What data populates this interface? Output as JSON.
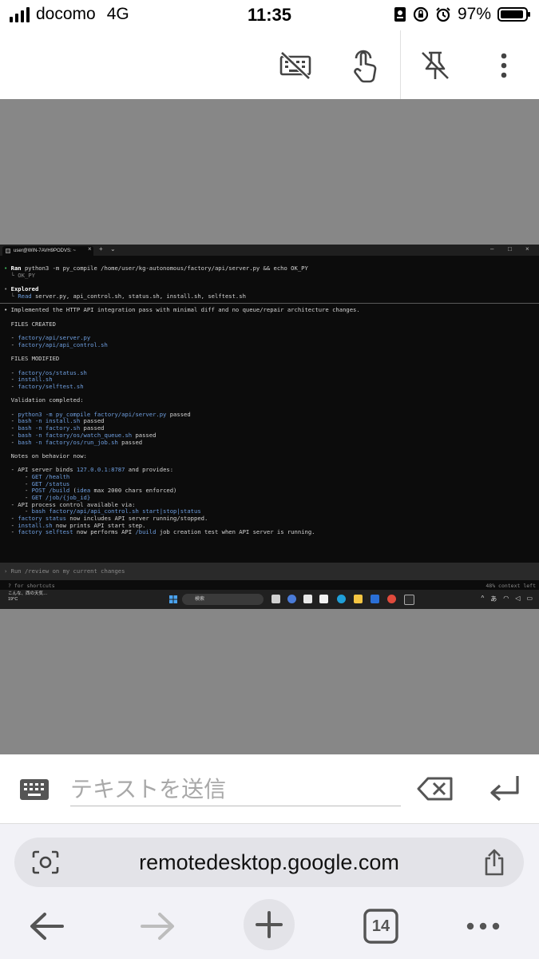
{
  "status_bar": {
    "carrier": "docomo",
    "network": "4G",
    "time": "11:35",
    "battery_percent": "97%",
    "battery_level": 0.97
  },
  "terminal": {
    "tab_title": "user@WIN-7AVH9PODVS: ~",
    "lines": [
      {
        "segs": [
          {
            "t": "• ",
            "c": "green"
          },
          {
            "t": "Ran ",
            "c": "bold"
          },
          {
            "t": "python3 -m py_compile /home/user/kg-autonomous/factory/api/server.py && echo OK_PY",
            "c": ""
          }
        ]
      },
      {
        "segs": [
          {
            "t": "  └ OK_PY",
            "c": "dim"
          }
        ]
      },
      {
        "segs": [
          {
            "t": "",
            "c": ""
          }
        ]
      },
      {
        "segs": [
          {
            "t": "• ",
            "c": "dim"
          },
          {
            "t": "Explored",
            "c": "bold"
          }
        ]
      },
      {
        "segs": [
          {
            "t": "  └ ",
            "c": "dim"
          },
          {
            "t": "Read ",
            "c": "blue"
          },
          {
            "t": "server.py, api_control.sh, status.sh, install.sh, selftest.sh",
            "c": ""
          }
        ]
      },
      {
        "sep": true
      },
      {
        "segs": [
          {
            "t": "• Implemented the HTTP API integration pass with minimal diff and no queue/repair architecture changes.",
            "c": ""
          }
        ]
      },
      {
        "segs": [
          {
            "t": "",
            "c": ""
          }
        ]
      },
      {
        "segs": [
          {
            "t": "  FILES CREATED",
            "c": ""
          }
        ]
      },
      {
        "segs": [
          {
            "t": "",
            "c": ""
          }
        ]
      },
      {
        "segs": [
          {
            "t": "  - ",
            "c": ""
          },
          {
            "t": "factory/api/server.py",
            "c": "blue"
          }
        ]
      },
      {
        "segs": [
          {
            "t": "  - ",
            "c": ""
          },
          {
            "t": "factory/api/api_control.sh",
            "c": "blue"
          }
        ]
      },
      {
        "segs": [
          {
            "t": "",
            "c": ""
          }
        ]
      },
      {
        "segs": [
          {
            "t": "  FILES MODIFIED",
            "c": ""
          }
        ]
      },
      {
        "segs": [
          {
            "t": "",
            "c": ""
          }
        ]
      },
      {
        "segs": [
          {
            "t": "  - ",
            "c": ""
          },
          {
            "t": "factory/os/status.sh",
            "c": "blue"
          }
        ]
      },
      {
        "segs": [
          {
            "t": "  - ",
            "c": ""
          },
          {
            "t": "install.sh",
            "c": "blue"
          }
        ]
      },
      {
        "segs": [
          {
            "t": "  - ",
            "c": ""
          },
          {
            "t": "factory/selftest.sh",
            "c": "blue"
          }
        ]
      },
      {
        "segs": [
          {
            "t": "",
            "c": ""
          }
        ]
      },
      {
        "segs": [
          {
            "t": "  Validation completed:",
            "c": ""
          }
        ]
      },
      {
        "segs": [
          {
            "t": "",
            "c": ""
          }
        ]
      },
      {
        "segs": [
          {
            "t": "  - ",
            "c": ""
          },
          {
            "t": "python3 -m py_compile factory/api/server.py",
            "c": "blue"
          },
          {
            "t": " passed",
            "c": ""
          }
        ]
      },
      {
        "segs": [
          {
            "t": "  - ",
            "c": ""
          },
          {
            "t": "bash -n install.sh",
            "c": "blue"
          },
          {
            "t": " passed",
            "c": ""
          }
        ]
      },
      {
        "segs": [
          {
            "t": "  - ",
            "c": ""
          },
          {
            "t": "bash -n factory.sh",
            "c": "blue"
          },
          {
            "t": " passed",
            "c": ""
          }
        ]
      },
      {
        "segs": [
          {
            "t": "  - ",
            "c": ""
          },
          {
            "t": "bash -n factory/os/watch_queue.sh",
            "c": "blue"
          },
          {
            "t": " passed",
            "c": ""
          }
        ]
      },
      {
        "segs": [
          {
            "t": "  - ",
            "c": ""
          },
          {
            "t": "bash -n factory/os/run_job.sh",
            "c": "blue"
          },
          {
            "t": " passed",
            "c": ""
          }
        ]
      },
      {
        "segs": [
          {
            "t": "",
            "c": ""
          }
        ]
      },
      {
        "segs": [
          {
            "t": "  Notes on behavior now:",
            "c": ""
          }
        ]
      },
      {
        "segs": [
          {
            "t": "",
            "c": ""
          }
        ]
      },
      {
        "segs": [
          {
            "t": "  - API server binds ",
            "c": ""
          },
          {
            "t": "127.0.0.1:8787",
            "c": "blue"
          },
          {
            "t": " and provides:",
            "c": ""
          }
        ]
      },
      {
        "segs": [
          {
            "t": "      - ",
            "c": ""
          },
          {
            "t": "GET /health",
            "c": "blue"
          }
        ]
      },
      {
        "segs": [
          {
            "t": "      - ",
            "c": ""
          },
          {
            "t": "GET /status",
            "c": "blue"
          }
        ]
      },
      {
        "segs": [
          {
            "t": "      - ",
            "c": ""
          },
          {
            "t": "POST /build",
            "c": "blue"
          },
          {
            "t": " (",
            "c": ""
          },
          {
            "t": "idea",
            "c": "blue"
          },
          {
            "t": " max 2000 chars enforced)",
            "c": ""
          }
        ]
      },
      {
        "segs": [
          {
            "t": "      - ",
            "c": ""
          },
          {
            "t": "GET /job/{job_id}",
            "c": "blue"
          }
        ]
      },
      {
        "segs": [
          {
            "t": "  - API process control available via:",
            "c": ""
          }
        ]
      },
      {
        "segs": [
          {
            "t": "      - ",
            "c": ""
          },
          {
            "t": "bash factory/api/api_control.sh start|stop|status",
            "c": "blue"
          }
        ]
      },
      {
        "segs": [
          {
            "t": "  - ",
            "c": ""
          },
          {
            "t": "factory status",
            "c": "blue"
          },
          {
            "t": " now includes API server running/stopped.",
            "c": ""
          }
        ]
      },
      {
        "segs": [
          {
            "t": "  - ",
            "c": ""
          },
          {
            "t": "install.sh",
            "c": "blue"
          },
          {
            "t": " now prints API start step.",
            "c": ""
          }
        ]
      },
      {
        "segs": [
          {
            "t": "  - ",
            "c": ""
          },
          {
            "t": "factory selftest",
            "c": "blue"
          },
          {
            "t": " now performs API ",
            "c": ""
          },
          {
            "t": "/build",
            "c": "blue"
          },
          {
            "t": " job creation test when API server is running.",
            "c": ""
          }
        ]
      }
    ],
    "prompt_placeholder": "› Run /review on my current changes",
    "shortcuts_hint": "? for shortcuts",
    "context_left": "48% context left"
  },
  "windows_taskbar": {
    "weather_line1": "こんな、西の天気…",
    "weather_line2": "19°C",
    "search_placeholder": "検索"
  },
  "input_bar": {
    "placeholder": "テキストを送信"
  },
  "browser": {
    "url": "remotedesktop.google.com",
    "tab_count": "14"
  }
}
